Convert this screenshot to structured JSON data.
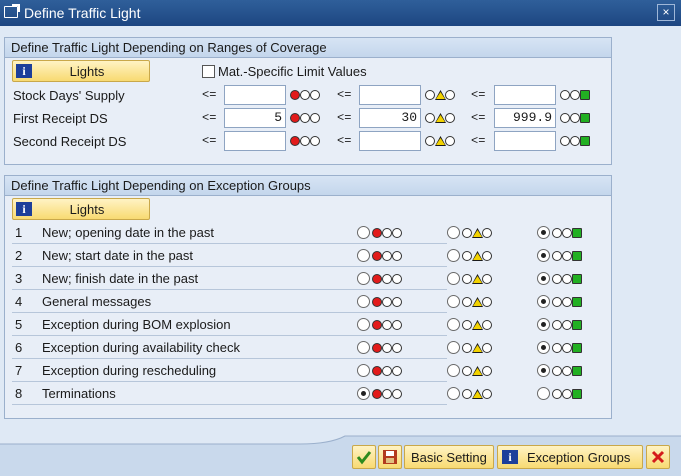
{
  "window": {
    "title": "Define Traffic Light",
    "close_label": "×"
  },
  "coverage": {
    "heading": "Define Traffic Light Depending on Ranges of Coverage",
    "lights_label": "Lights",
    "mat_specific_label": "Mat.-Specific Limit Values",
    "mat_specific_checked": false,
    "op": "<=",
    "rows": [
      {
        "label": "Stock Days' Supply",
        "red": "",
        "yellow": "",
        "green": ""
      },
      {
        "label": "First Receipt DS",
        "red": "5",
        "yellow": "30",
        "green": "999.9"
      },
      {
        "label": "Second Receipt DS",
        "red": "",
        "yellow": "",
        "green": ""
      }
    ]
  },
  "exceptions": {
    "heading": "Define Traffic Light Depending on Exception Groups",
    "lights_label": "Lights",
    "rows": [
      {
        "num": "1",
        "label": "New; opening date in the past",
        "selected": "green"
      },
      {
        "num": "2",
        "label": "New; start date in the past",
        "selected": "green"
      },
      {
        "num": "3",
        "label": "New; finish date in the past",
        "selected": "green"
      },
      {
        "num": "4",
        "label": "General messages",
        "selected": "green"
      },
      {
        "num": "5",
        "label": "Exception during BOM explosion",
        "selected": "green"
      },
      {
        "num": "6",
        "label": "Exception during availability check",
        "selected": "green"
      },
      {
        "num": "7",
        "label": "Exception during rescheduling",
        "selected": "green"
      },
      {
        "num": "8",
        "label": "Terminations",
        "selected": "red"
      }
    ]
  },
  "footer": {
    "basic_setting_label": "Basic Setting",
    "exception_groups_label": "Exception Groups"
  },
  "colors": {
    "title_bar": "#1d4681",
    "button": "#f8da72",
    "red": "#e21b1b",
    "yellow": "#f2d200",
    "green": "#22b022"
  }
}
